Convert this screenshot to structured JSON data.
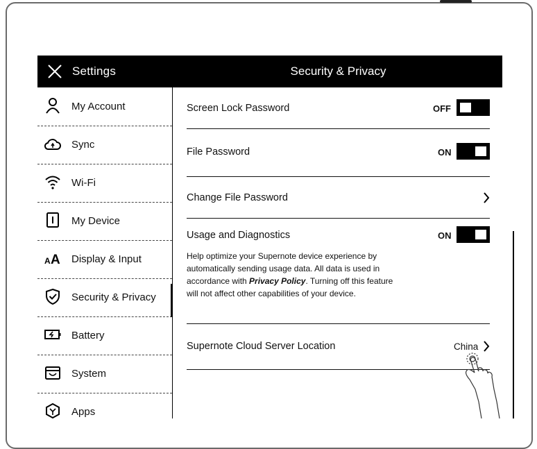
{
  "header": {
    "title": "Settings",
    "section_title": "Security & Privacy"
  },
  "sidebar": {
    "items": [
      {
        "label": "My Account",
        "icon": "person-icon"
      },
      {
        "label": "Sync",
        "icon": "cloud-sync-icon"
      },
      {
        "label": "Wi-Fi",
        "icon": "wifi-icon"
      },
      {
        "label": "My Device",
        "icon": "device-icon"
      },
      {
        "label": "Display & Input",
        "icon": "font-size-icon"
      },
      {
        "label": "Security & Privacy",
        "icon": "shield-check-icon",
        "active": true
      },
      {
        "label": "Battery",
        "icon": "battery-icon"
      },
      {
        "label": "System",
        "icon": "system-icon"
      },
      {
        "label": "Apps",
        "icon": "apps-icon"
      }
    ]
  },
  "content": {
    "screen_lock": {
      "label": "Screen Lock Password",
      "state": "OFF"
    },
    "file_password": {
      "label": "File Password",
      "state": "ON"
    },
    "change_file_password": {
      "label": "Change File Password"
    },
    "usage": {
      "label": "Usage and Diagnostics",
      "state": "ON",
      "desc_before": "Help optimize your Supernote device experience by automatically sending usage data. All data is used in accordance with ",
      "link": "Privacy Policy",
      "desc_after": ". Turning off this feature will not affect other capabilities of your device."
    },
    "cloud_location": {
      "label": "Supernote Cloud Server Location",
      "value": "China"
    }
  }
}
